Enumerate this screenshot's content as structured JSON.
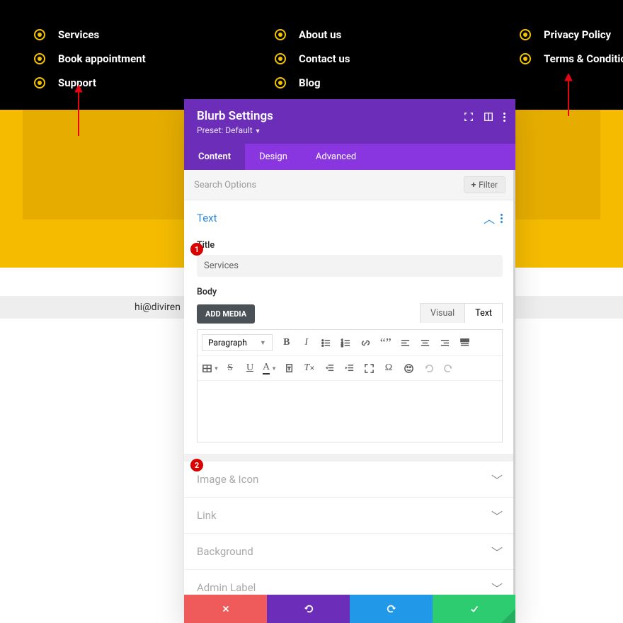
{
  "footer": {
    "col1": [
      {
        "label": "Services"
      },
      {
        "label": "Book appointment"
      },
      {
        "label": "Support"
      }
    ],
    "col2": [
      {
        "label": "About us"
      },
      {
        "label": "Contact us"
      },
      {
        "label": "Blog"
      }
    ],
    "col3": [
      {
        "label": "Privacy Policy"
      },
      {
        "label": "Terms & Conditions"
      }
    ]
  },
  "email": "hi@diviren",
  "annotations": {
    "badge1": "1",
    "badge2": "2"
  },
  "modal": {
    "title": "Blurb Settings",
    "preset": "Preset: Default",
    "tabs": {
      "content": "Content",
      "design": "Design",
      "advanced": "Advanced"
    },
    "search_placeholder": "Search Options",
    "filter_label": "Filter",
    "sections": {
      "text": {
        "title": "Text",
        "title_label": "Title",
        "title_value": "Services",
        "body_label": "Body",
        "add_media": "ADD MEDIA",
        "visual": "Visual",
        "text_tab": "Text",
        "paragraph": "Paragraph"
      },
      "image_icon": "Image & Icon",
      "link": "Link",
      "background": "Background",
      "admin_label": "Admin Label"
    }
  }
}
